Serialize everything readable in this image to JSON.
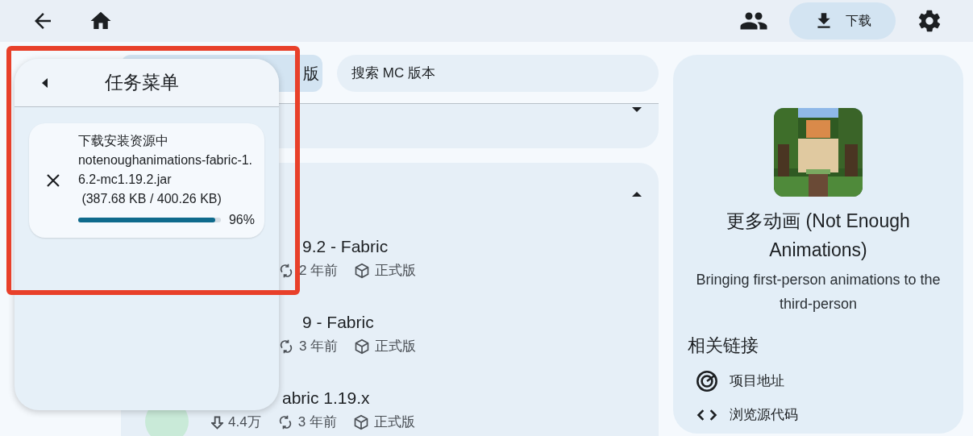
{
  "top_bar": {
    "download_button": {
      "label": "下载",
      "selected": true
    }
  },
  "filter_chip": {
    "label": "版",
    "selected": true
  },
  "search": {
    "placeholder": "搜索 MC 版本"
  },
  "sections": [
    {
      "expanded": false
    },
    {
      "expanded": true,
      "items": [
        {
          "title": "9.2 - Fabric",
          "updated": "2 年前",
          "type": "正式版"
        },
        {
          "title": "9 - Fabric",
          "updated": "3 年前",
          "type": "正式版"
        },
        {
          "title": "abric 1.19.x",
          "downloads": "4.4万",
          "updated": "3 年前",
          "type": "正式版"
        }
      ]
    }
  ],
  "task_menu": {
    "title": "任务菜单",
    "tasks": [
      {
        "status": "下载安装资源中",
        "file": "notenoughanimations-fabric-1.6.2-mc1.19.2.jar",
        "size": " (387.68 KB / 400.26 KB)",
        "level": 0.96,
        "percent": "96%"
      }
    ]
  },
  "detail": {
    "title": "更多动画 (Not Enough Animations)",
    "description": "Bringing first-person animations to the third-person",
    "links_heading": "相关链接",
    "links": [
      {
        "kind": "project",
        "label": "项目地址"
      },
      {
        "kind": "source",
        "label": "浏览源代码"
      }
    ]
  }
}
